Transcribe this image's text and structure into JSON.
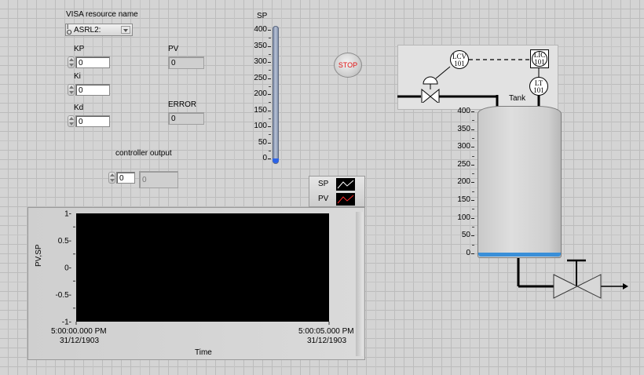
{
  "visa": {
    "label": "VISA resource name",
    "value": "ASRL2:"
  },
  "kp": {
    "label": "KP",
    "value": "0"
  },
  "ki": {
    "label": "Ki",
    "value": "0"
  },
  "kd": {
    "label": "Kd",
    "value": "0"
  },
  "pv": {
    "label": "PV",
    "value": "0"
  },
  "error": {
    "label": "ERROR",
    "value": "0"
  },
  "controller_output": {
    "label": "controller output",
    "control_value": "0",
    "indicator_value": "0"
  },
  "sp_slider": {
    "label": "SP",
    "ticks": [
      "400",
      "350",
      "300",
      "250",
      "200",
      "150",
      "100",
      "50",
      "0"
    ],
    "value": 0
  },
  "stop_button": {
    "label": "STOP",
    "color": "#e01010"
  },
  "legend": {
    "items": [
      "SP",
      "PV"
    ]
  },
  "chart_data": {
    "type": "line",
    "ylabel": "PV,SP",
    "xlabel": "Time",
    "y_ticks": [
      "1",
      "0.5",
      "0",
      "-0.5",
      "-1"
    ],
    "ylim": [
      -1,
      1
    ],
    "x_start": "5:00:00.000 PM",
    "x_start_date": "31/12/1903",
    "x_end": "5:00:05.000 PM",
    "x_end_date": "31/12/1903",
    "series": [
      {
        "name": "SP",
        "values": []
      },
      {
        "name": "PV",
        "values": []
      }
    ],
    "plot_bg": "#000000"
  },
  "tank": {
    "label": "Tank",
    "ticks": [
      "400",
      "350",
      "300",
      "250",
      "200",
      "150",
      "100",
      "50",
      "0"
    ],
    "level": 0,
    "level_color": "#3a8fd8",
    "lcv_line1": "LCV",
    "lcv_line2": "101",
    "lic_line1": "LIC",
    "lic_line2": "101",
    "lt_line1": "LT",
    "lt_line2": "101"
  }
}
